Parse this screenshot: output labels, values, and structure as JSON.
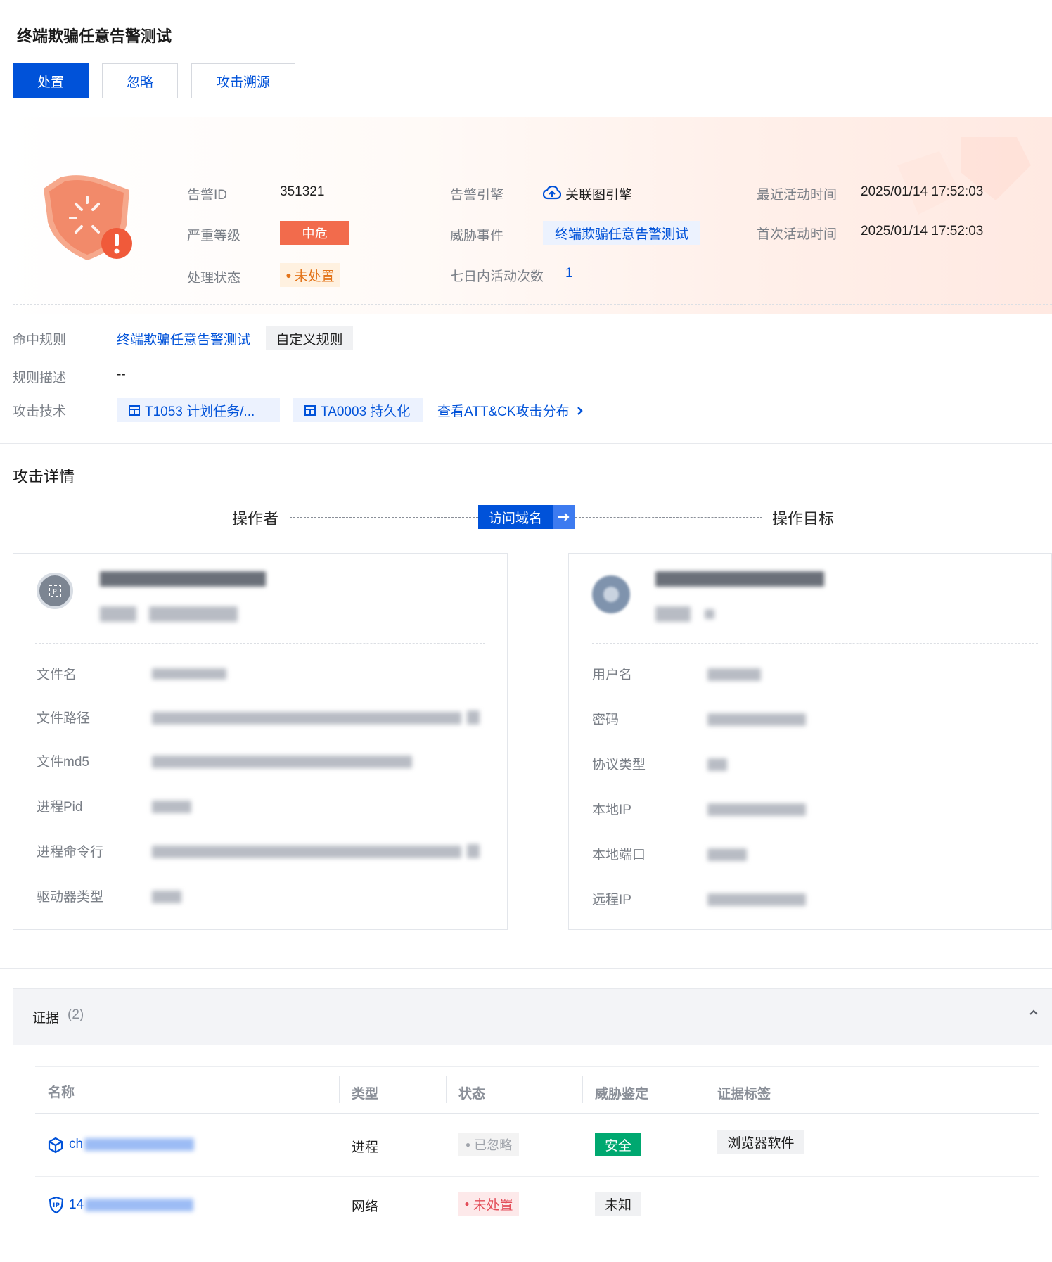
{
  "header": {
    "title": "终端欺骗任意告警测试",
    "buttons": {
      "handle": "处置",
      "ignore": "忽略",
      "trace": "攻击溯源"
    }
  },
  "summary": {
    "alert_id_label": "告警ID",
    "alert_id": "351321",
    "severity_label": "严重等级",
    "severity": "中危",
    "status_label": "处理状态",
    "status": "未处置",
    "engine_label": "告警引擎",
    "engine": "关联图引擎",
    "event_label": "威胁事件",
    "event": "终端欺骗任意告警测试",
    "activity_count_label": "七日内活动次数",
    "activity_count": "1",
    "last_active_label": "最近活动时间",
    "last_active": "2025/01/14 17:52:03",
    "first_active_label": "首次活动时间",
    "first_active": "2025/01/14 17:52:03"
  },
  "rule": {
    "hit_label": "命中规则",
    "hit_link": "终端欺骗任意告警测试",
    "hit_tag": "自定义规则",
    "desc_label": "规则描述",
    "desc": "--",
    "tech_label": "攻击技术",
    "tech1": "T1053 计划任务/...",
    "tech2": "TA0003 持久化",
    "attck_link": "查看ATT&CK攻击分布"
  },
  "attack": {
    "section_title": "攻击详情",
    "operator": "操作者",
    "action": "访问域名",
    "target": "操作目标",
    "left_fields": [
      "文件名",
      "文件路径",
      "文件md5",
      "进程Pid",
      "进程命令行",
      "驱动器类型"
    ],
    "right_fields": [
      "用户名",
      "密码",
      "协议类型",
      "本地IP",
      "本地端口",
      "远程IP"
    ]
  },
  "evidence": {
    "title": "证据",
    "count": "(2)",
    "columns": [
      "名称",
      "类型",
      "状态",
      "威胁鉴定",
      "证据标签"
    ],
    "rows": [
      {
        "name_prefix": "ch",
        "type": "进程",
        "status": "已忽略",
        "verdict": "安全",
        "tag": "浏览器软件"
      },
      {
        "name_prefix": "14",
        "type": "网络",
        "status": "未处置",
        "verdict": "未知",
        "tag": ""
      }
    ]
  },
  "colors": {
    "primary": "#0052d9",
    "danger": "#f26b4c",
    "warning": "#e37318",
    "success": "#00a870",
    "error": "#e34d59"
  },
  "icons": [
    "shield-alert-icon",
    "cloud-engine-icon",
    "grid-tech-icon",
    "chevron-right-icon",
    "arrow-right-icon",
    "process-avatar-icon",
    "host-avatar-icon",
    "chevron-up-icon",
    "cube-icon",
    "ip-shield-icon"
  ]
}
